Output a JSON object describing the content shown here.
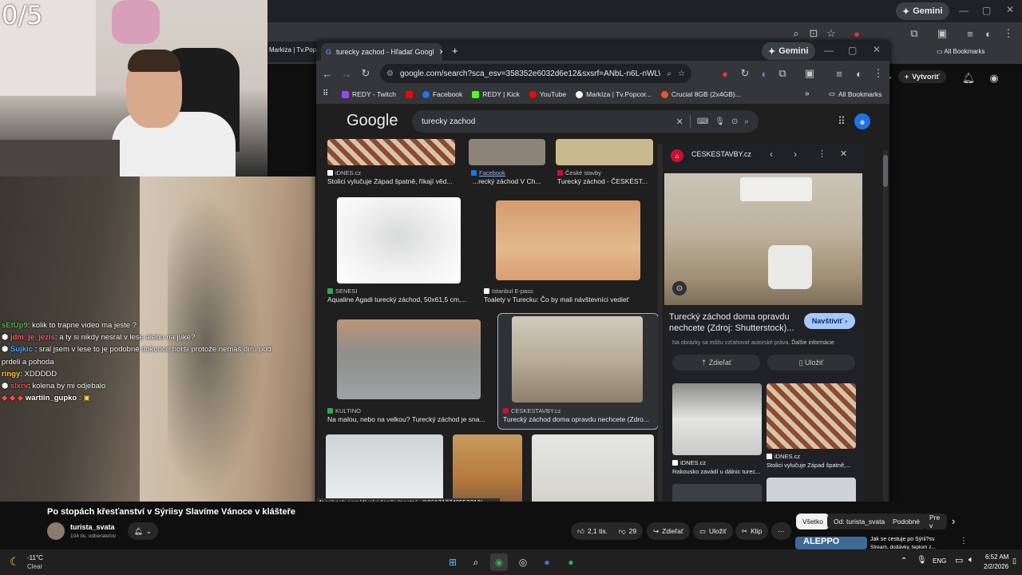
{
  "stream": {
    "sub_counter": "0/5",
    "chat": [
      {
        "user": "sEtUp9",
        "user_color": "#59b04f",
        "text": ": kolik to trapne video ma jeste ?"
      },
      {
        "user": "jdm_je_jezis",
        "user_color": "#ff5b5b",
        "text": ": a ty si nikdy nesral v lese alebo na juke?"
      },
      {
        "user": "Sujkic",
        "user_color": "#4aa3ff",
        "text": ": sral jsem v lese to je podobné dokonce horší protože nemáš díru pod prdeli a pohoda"
      },
      {
        "user": "ringy",
        "user_color": "#ffcc33",
        "text": ": XDDDDD"
      },
      {
        "user": "slxrv",
        "user_color": "#ff4d4d",
        "text": ": kolena by mi odjebalo"
      },
      {
        "user": "wartiin_gupko",
        "user_color": "#ffffff",
        "text": ":"
      }
    ]
  },
  "back_browser": {
    "gemini_label": "Gemini",
    "tab_label": "Markiza | Tv.Popco",
    "all_bookmarks": "All Bookmarks",
    "create_label": "Vytvoriť"
  },
  "browser": {
    "tab_title": "turecky zachod - Hľadať Googl",
    "gemini_label": "Gemini",
    "url": "google.com/search?sca_esv=358352e6032d6e12&sxsrf=ANbL-n6L-nWLWh34lzJem/...",
    "bookmarks": [
      {
        "label": "REDY - Twitch",
        "color": "#9146ff"
      },
      {
        "label": "",
        "color": "#ff0000"
      },
      {
        "label": "Facebook",
        "color": "#1877f2"
      },
      {
        "label": "REDY | Kick",
        "color": "#53fc18"
      },
      {
        "label": "YouTube",
        "color": "#ff0000"
      },
      {
        "label": "Markíza | Tv.Popcor...",
        "color": "#ffffff"
      },
      {
        "label": "Crucial 8GB (2x4GB)...",
        "color": "#e8542c"
      }
    ],
    "all_bookmarks": "All Bookmarks",
    "status_url": "facebook.com/divokedeniky/posts/.../1861712740553313/"
  },
  "google": {
    "logo": "Google",
    "query": "turecky zachod",
    "results": [
      {
        "source": "iDNES.cz",
        "title": "Stolici vylučuje Západ špatně, říkají věd..."
      },
      {
        "source": "Facebook",
        "title": "...recký záchod V Ch..."
      },
      {
        "source": "České stavby",
        "title": "Turecký záchod - ČESKÉST..."
      },
      {
        "source": "SENESI",
        "title": "Aqualine Agadi turecký záchod, 50x61,5 cm,..."
      },
      {
        "source": "Istanbul E-pass",
        "title": "Toalety v Turecku: Čo by mali návštevníci vedieť"
      },
      {
        "source": "KULTINO",
        "title": "Na malou, nebo na velkou? Turecký záchod je sna..."
      },
      {
        "source": "CESKESTAVBY.cz",
        "title": "Turecký záchod doma opravdu nechcete (Zdro..."
      }
    ],
    "panel": {
      "source": "CESKESTAVBY.cz",
      "title": "Turecký záchod doma opravdu nechcete (Zdroj: Shutterstock)...",
      "visit": "Navštíviť",
      "notice": "Na obrázky sa môžu vzťahovať autorské práva.",
      "more": "Ďalšie informácie",
      "share": "Zdieľať",
      "save": "Uložiť",
      "related": [
        {
          "source": "iDNES.cz",
          "title": "Rakousko zavádí u dálnic turec..."
        },
        {
          "source": "iDNES.cz",
          "title": "Stolici vylučuje Západ špatně,..."
        }
      ]
    }
  },
  "video": {
    "title": "Po stopách křesťanství v Sýriisy Slavíme Vánoce v klášteře",
    "channel": "turista_svata",
    "subs": "104 tis. odberateľov",
    "likes": "2,1 tis.",
    "dislikes": "29",
    "share": "Zdieľať",
    "save": "Uložiť",
    "clip": "Klip",
    "chips": [
      "Všetko",
      "Od: turista_svata",
      "Podobné",
      "Pre v"
    ],
    "suggest_title": "Jak se cestuje po Sýrii?sv",
    "suggest_sub": "Stream, dodávky, teplom z...",
    "suggest_thumb": "ALEPPO"
  },
  "taskbar": {
    "temp": "-11°C",
    "weather": "Clear",
    "lang": "ENG",
    "time": "6:52 AM",
    "date": "2/2/2026"
  }
}
